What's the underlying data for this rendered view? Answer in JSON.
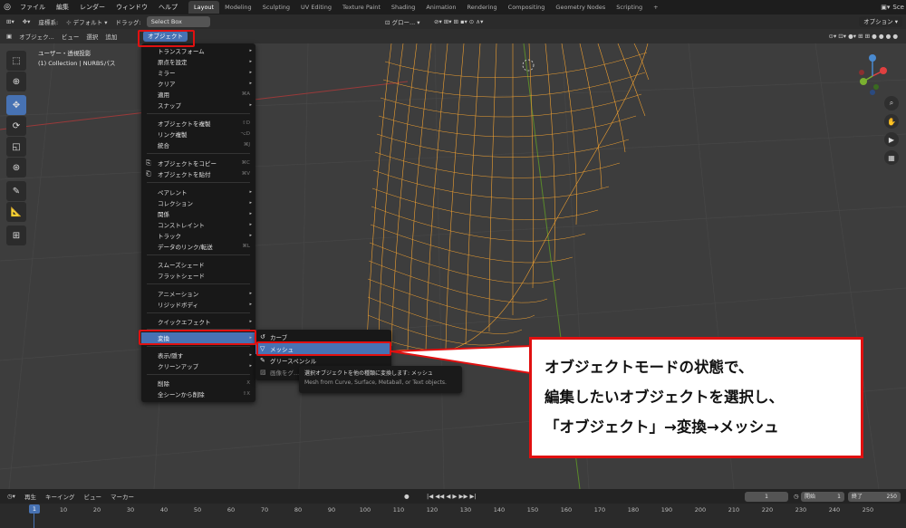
{
  "topbar": {
    "menus": [
      "ファイル",
      "編集",
      "レンダー",
      "ウィンドウ",
      "ヘルプ"
    ],
    "workspaces": [
      "Layout",
      "Modeling",
      "Sculpting",
      "UV Editing",
      "Texture Paint",
      "Shading",
      "Animation",
      "Rendering",
      "Compositing",
      "Geometry Nodes",
      "Scripting"
    ],
    "active_workspace": "Layout",
    "add_tab": "+",
    "scene_label": "Sce"
  },
  "header1": {
    "transform_orientation_label": "座標系:",
    "pivot_label": "デフォルト",
    "drag_label": "ドラッグ:",
    "drag_value": "Select Box",
    "global_label": "グロー...",
    "options_label": "オプション"
  },
  "header2": {
    "mode_label": "オブジェク...",
    "view_menu": "ビュー",
    "select_menu": "選択",
    "add_menu": "追加",
    "object_menu": "オブジェクト"
  },
  "viewport": {
    "view_name": "ユーザー・透視投影",
    "collection_info": "(1) Collection | NURBSパス"
  },
  "object_menu": {
    "items": [
      {
        "label": "トランスフォーム",
        "arrow": "▸"
      },
      {
        "label": "原点を設定",
        "arrow": "▸"
      },
      {
        "label": "ミラー",
        "arrow": "▸"
      },
      {
        "label": "クリア",
        "arrow": "▸"
      },
      {
        "label": "適用",
        "shortcut": "⌘A"
      },
      {
        "label": "スナップ",
        "arrow": "▸"
      },
      {
        "label": "オブジェクトを複製",
        "shortcut": "⇧D"
      },
      {
        "label": "リンク複製",
        "shortcut": "⌥D"
      },
      {
        "label": "統合",
        "shortcut": "⌘J"
      },
      {
        "label": "オブジェクトをコピー",
        "shortcut": "⌘C"
      },
      {
        "label": "オブジェクトを貼付",
        "shortcut": "⌘V"
      },
      {
        "label": "ペアレント",
        "arrow": "▸"
      },
      {
        "label": "コレクション",
        "arrow": "▸"
      },
      {
        "label": "関係",
        "arrow": "▸"
      },
      {
        "label": "コンストレイント",
        "arrow": "▸"
      },
      {
        "label": "トラック",
        "arrow": "▸"
      },
      {
        "label": "データのリンク/転送",
        "shortcut": "⌘L"
      },
      {
        "label": "スムーズシェード"
      },
      {
        "label": "フラットシェード"
      },
      {
        "label": "アニメーション",
        "arrow": "▸"
      },
      {
        "label": "リジッドボディ",
        "arrow": "▸"
      },
      {
        "label": "クイックエフェクト",
        "arrow": "▸"
      },
      {
        "label": "変換",
        "arrow": "▸"
      },
      {
        "label": "表示/隠す",
        "arrow": "▸"
      },
      {
        "label": "クリーンアップ",
        "arrow": "▸"
      },
      {
        "label": "削除",
        "shortcut": "X"
      },
      {
        "label": "全シーンから削除",
        "shortcut": "⇧X"
      }
    ]
  },
  "convert_submenu": {
    "items": [
      "カーブ",
      "メッシュ",
      "グリースペンシル",
      "画像をグ..."
    ]
  },
  "tooltip": {
    "line1": "選択オブジェクトを他の種類に変換します: メッシュ",
    "line2": "Mesh from Curve, Surface, Metaball, or Text objects."
  },
  "callout": {
    "line1": "オブジェクトモードの状態で、",
    "line2": "編集したいオブジェクトを選択し、",
    "line3": "「オブジェクト」→変換→メッシュ"
  },
  "timeline": {
    "playback": "再生",
    "keying": "キーイング",
    "view": "ビュー",
    "marker": "マーカー",
    "current_frame": "1",
    "start_label": "開始",
    "start_value": "1",
    "end_label": "終了",
    "end_value": "250",
    "ruler": [
      "1",
      "10",
      "20",
      "30",
      "40",
      "50",
      "60",
      "70",
      "80",
      "90",
      "100",
      "110",
      "120",
      "130",
      "140",
      "150",
      "160",
      "170",
      "180",
      "190",
      "200",
      "210",
      "220",
      "230",
      "240",
      "250"
    ]
  },
  "colors": {
    "accent": "#4772b3",
    "wire": "#f0a030",
    "highlight_red": "#e01010"
  }
}
